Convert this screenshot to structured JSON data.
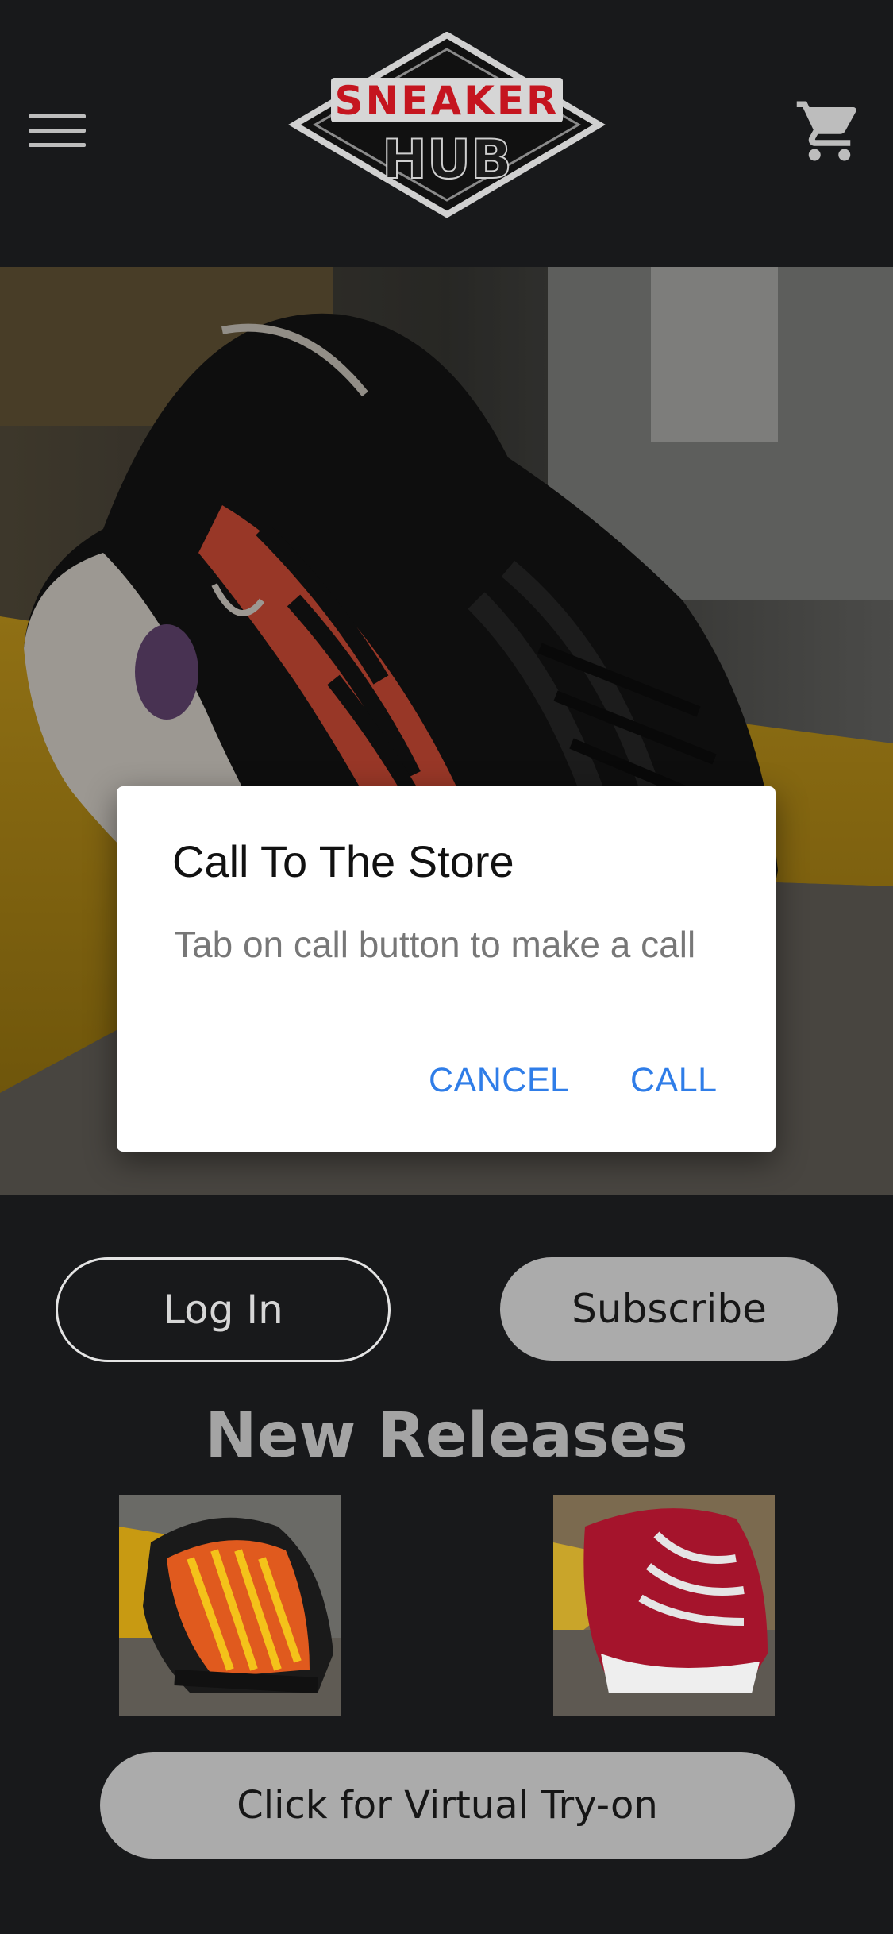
{
  "header": {
    "logo_top": "SNEAKER",
    "logo_bottom": "HUB"
  },
  "dialog": {
    "title": "Call To The Store",
    "message": "Tab on call button to make a call",
    "cancel_label": "CANCEL",
    "call_label": "CALL"
  },
  "actions": {
    "login_label": "Log In",
    "subscribe_label": "Subscribe"
  },
  "releases": {
    "title": "New Releases"
  },
  "tryon": {
    "label": "Click for Virtual Try-on"
  },
  "icons": {
    "menu": "menu-icon",
    "cart": "cart-icon"
  },
  "colors": {
    "background": "#18191b",
    "dialog_accent": "#2f7de8",
    "button_fill": "#ababab",
    "logo_red": "#c5151f"
  }
}
